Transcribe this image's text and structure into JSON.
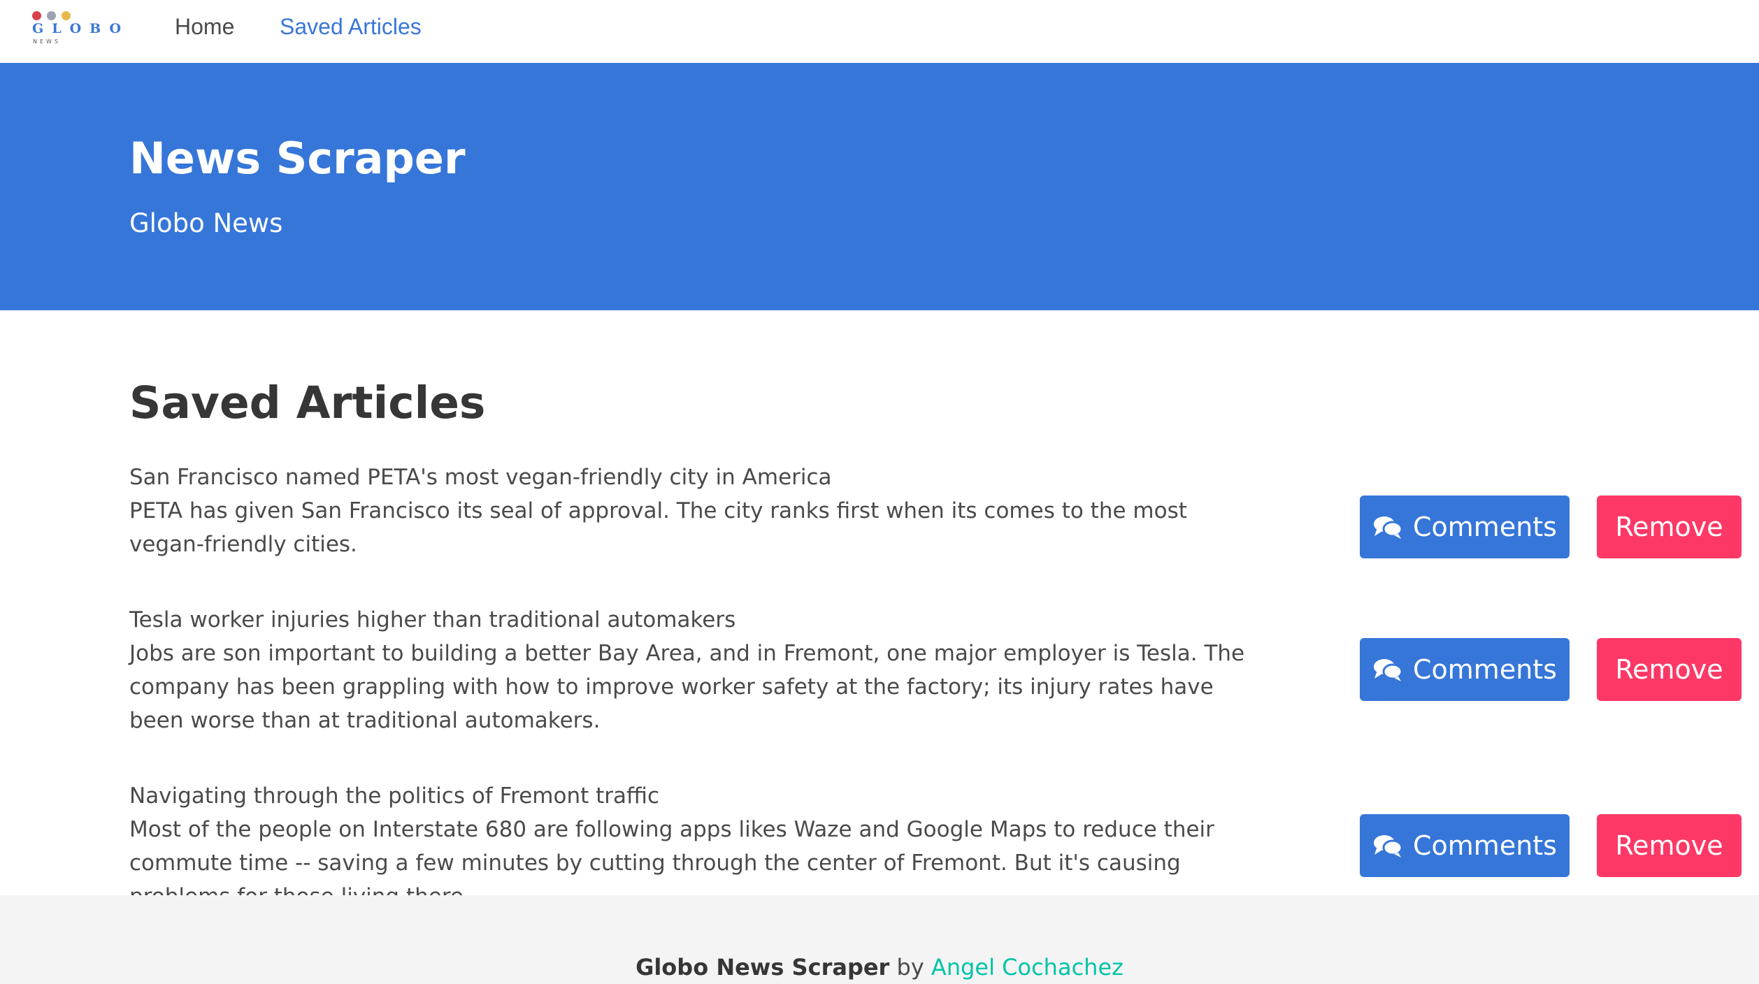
{
  "logo": {
    "word": "GLOBO",
    "sub": "NEWS",
    "dot_colors": [
      "#d94050",
      "#9aa4b5",
      "#e8b84a"
    ]
  },
  "nav": {
    "home_label": "Home",
    "saved_label": "Saved Articles"
  },
  "hero": {
    "title": "News Scraper",
    "subtitle": "Globo News"
  },
  "section": {
    "title": "Saved Articles"
  },
  "articles": [
    {
      "headline": "San Francisco named PETA's most vegan-friendly city in America",
      "summary": "PETA has given San Francisco its seal of approval. The city ranks first when its comes to the most vegan-friendly cities.",
      "comments_label": "Comments",
      "remove_label": "Remove"
    },
    {
      "headline": "Tesla worker injuries higher than traditional automakers",
      "summary": "Jobs are son important to building a better Bay Area, and in Fremont, one major employer is Tesla. The company has been grappling with how to improve worker safety at the factory; its injury rates have been worse than at traditional automakers.",
      "comments_label": "Comments",
      "remove_label": "Remove"
    },
    {
      "headline": "Navigating through the politics of Fremont traffic",
      "summary": "Most of the people on Interstate 680 are following apps likes Waze and Google Maps to reduce their commute time -- saving a few minutes by cutting through the center of Fremont. But it's causing problems for those living there.",
      "comments_label": "Comments",
      "remove_label": "Remove"
    }
  ],
  "footer": {
    "app_name": "Globo News Scraper",
    "by": "by",
    "author": "Angel Cochachez"
  },
  "colors": {
    "primary": "#3676d9",
    "danger": "#fe3866",
    "author_link": "#00c4a7"
  }
}
